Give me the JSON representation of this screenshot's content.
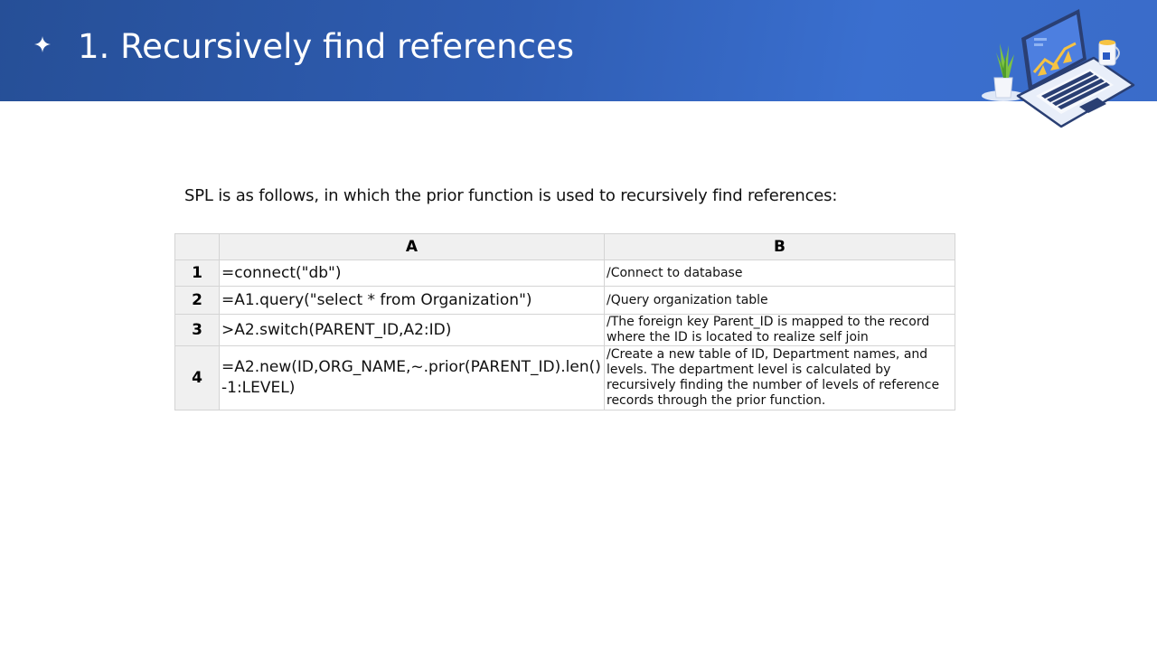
{
  "header": {
    "title": "1. Recursively find references"
  },
  "intro_text": "SPL is as follows, in which the prior function is used to recursively find references:",
  "table": {
    "column_headers": [
      "A",
      "B"
    ],
    "rows": [
      {
        "num": "1",
        "code": "=connect(\"db\")",
        "comment": "/Connect to database"
      },
      {
        "num": "2",
        "code": "=A1.query(\"select * from Organization\")",
        "comment": "/Query organization table"
      },
      {
        "num": "3",
        "code": ">A2.switch(PARENT_ID,A2:ID)",
        "comment": "/The foreign key Parent_ID is mapped to the record where the ID is located to realize self join"
      },
      {
        "num": "4",
        "code": "=A2.new(ID,ORG_NAME,~.prior(PARENT_ID).len()-1:LEVEL)",
        "comment": "/Create a new table of ID, Department names, and levels. The department level is calculated by recursively finding the number of levels of reference records through the prior function."
      }
    ]
  },
  "colors": {
    "banner": "#2f5db3",
    "header_cell": "#f0f0f0",
    "grid_line": "#d4d4d4"
  },
  "icons": {
    "bullet": "four-point-star-icon",
    "illustration": "laptop-illustration"
  }
}
